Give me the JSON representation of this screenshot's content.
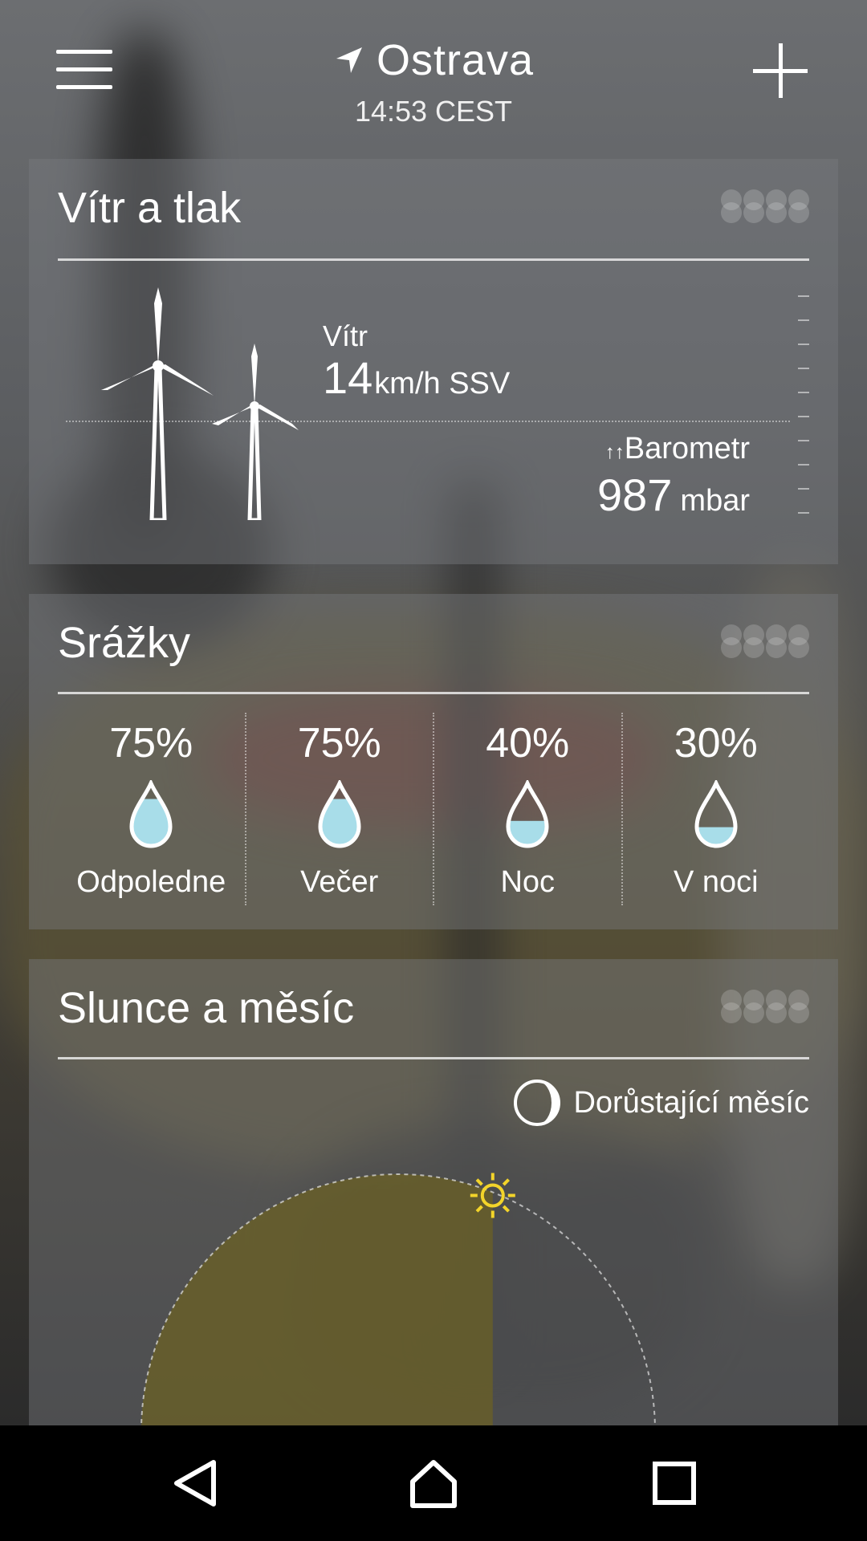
{
  "header": {
    "city": "Ostrava",
    "time": "14:53 CEST",
    "icons": {
      "menu": "hamburger-menu-icon",
      "location": "location-arrow-icon",
      "add": "plus-icon"
    }
  },
  "wind_card": {
    "title": "Vítr a tlak",
    "wind_label": "Vítr",
    "wind_speed": "14",
    "wind_unit": "km/h SSV",
    "pressure_label": "Barometr",
    "pressure_trend_icon": "double-up-arrow-icon",
    "pressure_value": "987",
    "pressure_unit": "mbar"
  },
  "precip_card": {
    "title": "Srážky",
    "periods": [
      {
        "percent": "75%",
        "label": "Odpoledne",
        "fill": 0.75
      },
      {
        "percent": "75%",
        "label": "Večer",
        "fill": 0.75
      },
      {
        "percent": "40%",
        "label": "Noc",
        "fill": 0.4
      },
      {
        "percent": "30%",
        "label": "V noci",
        "fill": 0.3
      }
    ]
  },
  "sun_card": {
    "title": "Slunce a měsíc",
    "moon_phase": "Dorůstající měsíc",
    "moon_icon": "waxing-moon-icon",
    "sun_icon": "sun-icon",
    "daylight_progress": 0.62
  },
  "navigation": {
    "back": "back-triangle-icon",
    "home": "home-icon",
    "recents": "recents-square-icon"
  },
  "colors": {
    "drop_fill": "#a8dde9",
    "sun_yellow": "#f3d42a",
    "daylight_fill": "#6b6024"
  }
}
